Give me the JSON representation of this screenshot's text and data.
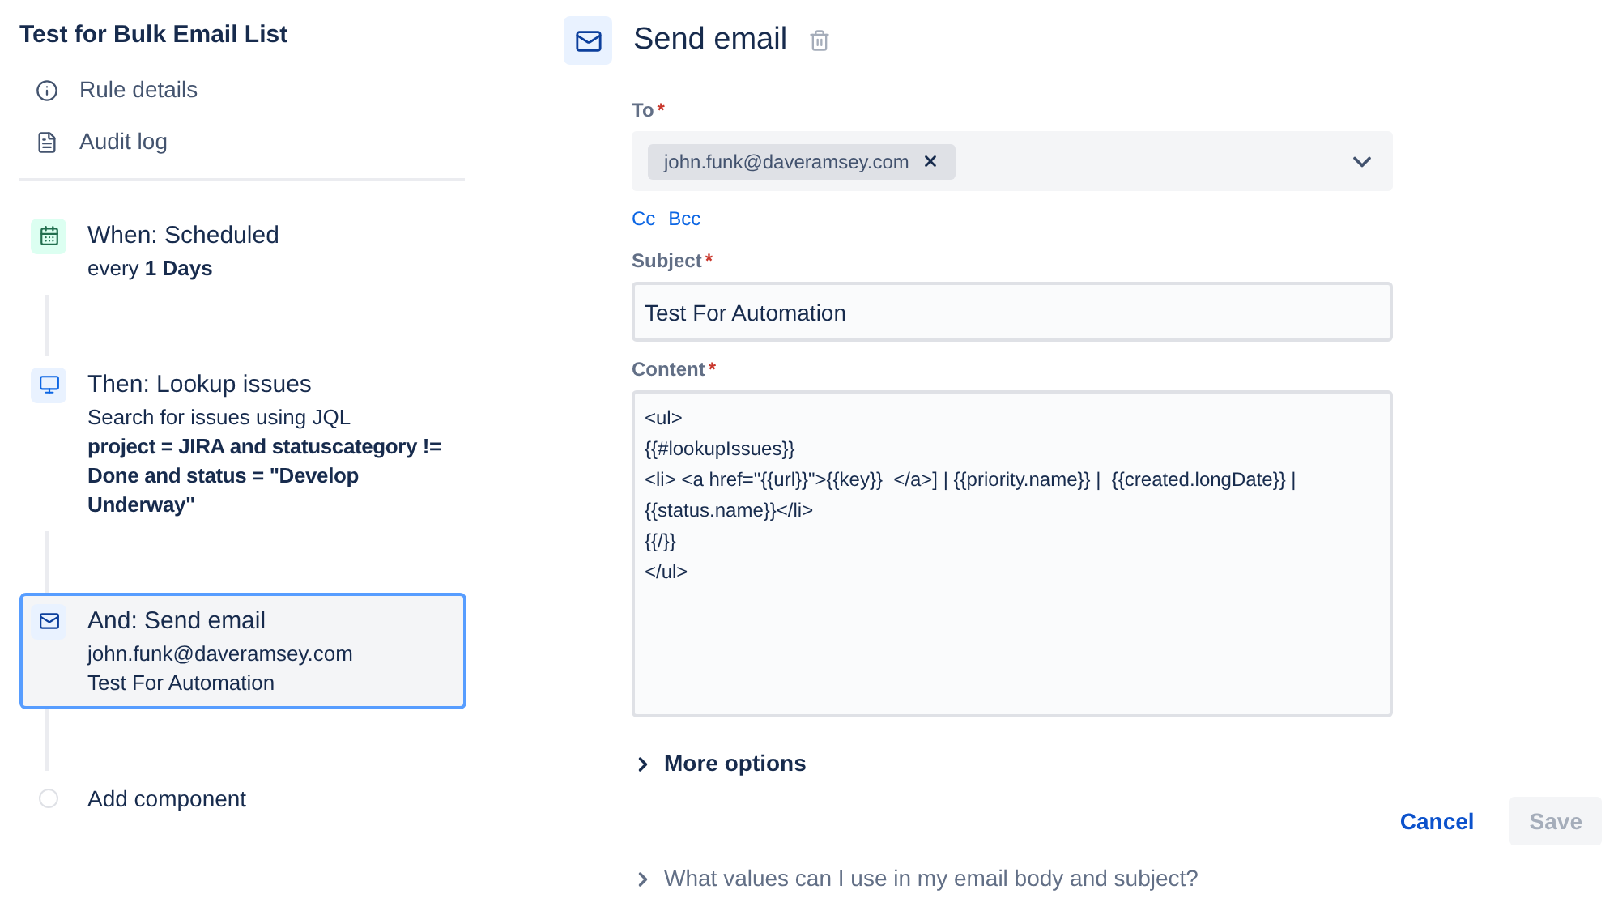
{
  "rule": {
    "title": "Test for Bulk Email List",
    "nav": [
      {
        "kind": "info",
        "label": "Rule details"
      },
      {
        "kind": "log",
        "label": "Audit log"
      }
    ],
    "steps": [
      {
        "kind": "trigger",
        "selected": false,
        "title": "When: Scheduled",
        "lines": [
          {
            "text": "every **1 Days**",
            "bold": false
          }
        ]
      },
      {
        "kind": "lookup",
        "selected": false,
        "title": "Then: Lookup issues",
        "lines": [
          {
            "text": "Search for issues using JQL",
            "bold": false
          },
          {
            "text": "project = JIRA and statuscategory != Done and status = \"Develop Underway\"",
            "bold": true
          }
        ]
      },
      {
        "kind": "email",
        "selected": true,
        "title": "And: Send email",
        "lines": [
          {
            "text": "john.funk@daveramsey.com",
            "bold": false
          },
          {
            "text": "Test For Automation",
            "bold": false
          }
        ]
      },
      {
        "kind": "add",
        "selected": false,
        "title": "Add component"
      }
    ]
  },
  "editor": {
    "title": "Send email",
    "to": {
      "label": "To",
      "required": true,
      "required_mark": "*",
      "recipients": [
        "john.funk@daveramsey.com"
      ]
    },
    "links": [
      "Cc",
      "Bcc"
    ],
    "subject": {
      "label": "Subject",
      "required": true,
      "required_mark": "*",
      "value": "Test For Automation"
    },
    "content": {
      "label": "Content",
      "required": true,
      "required_mark": "*",
      "value": "<ul>\n{{#lookupIssues}}\n<li> <a href=\"{{url}}\">{{key}}  </a>] | {{priority.name}} |  {{created.longDate}} |\n{{status.name}}</li>\n{{/}}\n</ul>"
    },
    "more_options": {
      "label": "More options",
      "expanded": false
    },
    "buttons": [
      {
        "kind": "subtle",
        "label": "Cancel",
        "disabled": false
      },
      {
        "kind": "primary",
        "label": "Save",
        "disabled": true
      }
    ],
    "help": {
      "label": "What values can I use in my email body and subject?",
      "expanded": false
    }
  }
}
